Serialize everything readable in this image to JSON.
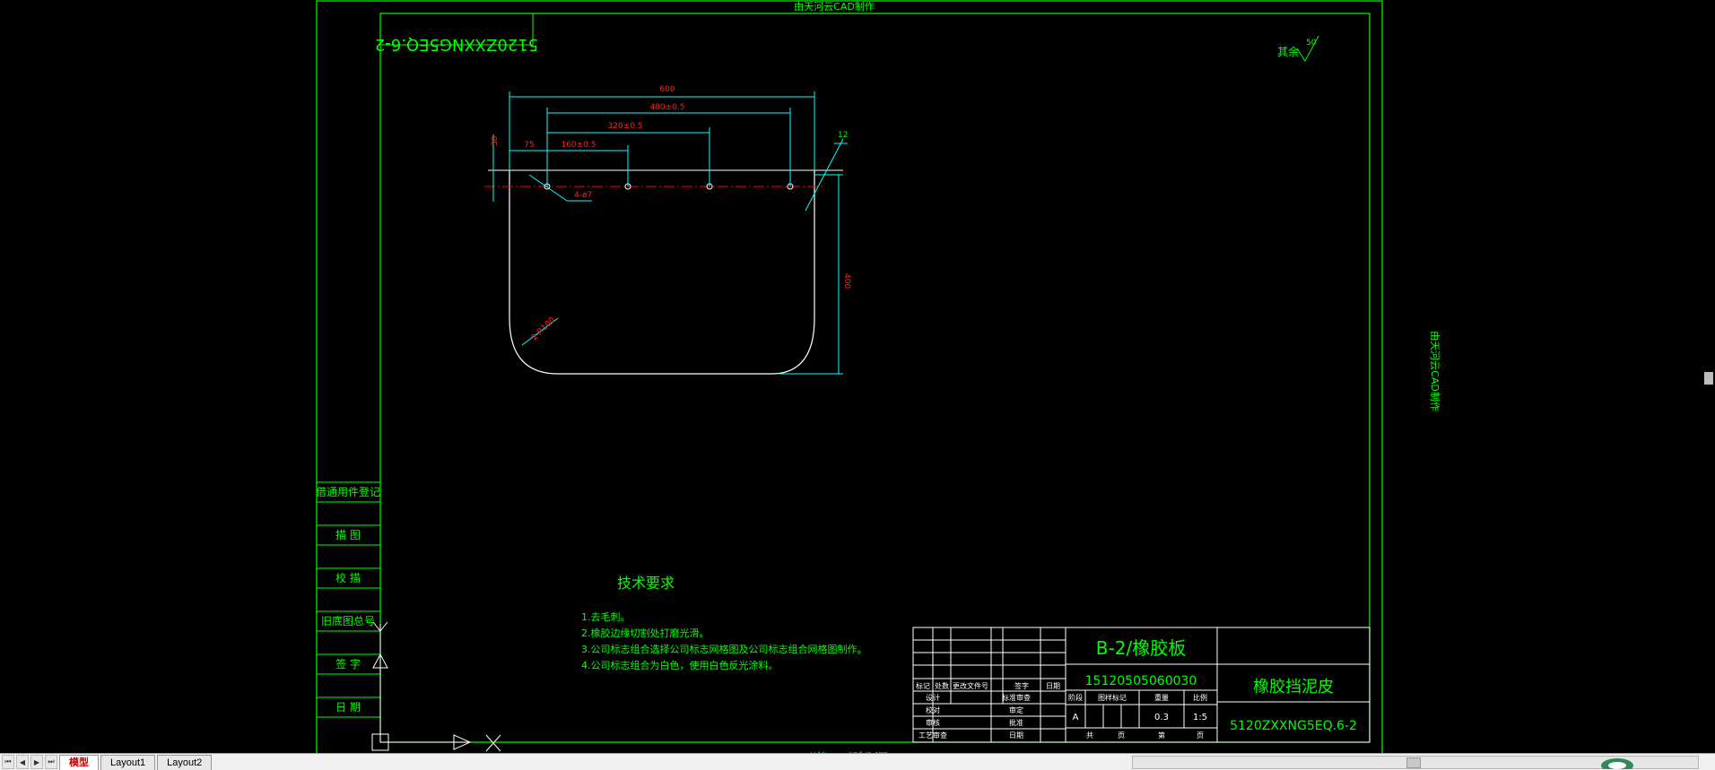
{
  "colors": {
    "frame": "#00ff00",
    "dimension": "#00ffff",
    "dim_text": "#ff2020",
    "note_text": "#00ff00",
    "outline": "#ffffff",
    "centerline": "#ff0000"
  },
  "watermark": "由天河云CAD制作",
  "drawing_number_mirrored": "5120ZXXNG5EQ.6-2",
  "roughness": {
    "label": "其余",
    "value": "50"
  },
  "dimensions": {
    "width_total": "600",
    "hole_span_480": "480±0.5",
    "hole_span_320": "320±0.5",
    "hole_span_160": "160±0.5",
    "offset_75": "75",
    "offset_30": "30",
    "height_400": "400",
    "holes": "4-ø7",
    "radius": "2-R100",
    "thickness": "12"
  },
  "left_column": [
    "借通用件登记",
    "描 图",
    "校 描",
    "旧底图总号",
    "签 字",
    "日 期"
  ],
  "tech_requirements": {
    "title": "技术要求",
    "items": [
      "1.去毛刺。",
      "2.橡胶边缘切割处打磨光滑。",
      "3.公司标志组合选择公司标志网格图及公司标志组合网格图制作。",
      "4.公司标志组合为白色，使用白色反光涂料。"
    ]
  },
  "title_block": {
    "material": "B-2/橡胶板",
    "part_code": "15120505060030",
    "part_name": "橡胶挡泥皮",
    "drawing_number": "5120ZXXNG5EQ.6-2",
    "change_headers": [
      "标记",
      "处数",
      "更改文件号",
      "签字",
      "日期"
    ],
    "sign_rows": [
      [
        "设计",
        "",
        "标准审查"
      ],
      [
        "校对",
        "",
        "审定"
      ],
      [
        "审核",
        "",
        "批准"
      ],
      [
        "工艺审查",
        "",
        "日期"
      ]
    ],
    "stage_headers": [
      "阶段",
      "图样标记",
      "重量",
      "比例"
    ],
    "stage_values": [
      "A",
      "",
      "",
      "",
      "0.3",
      "1:5"
    ],
    "sheet_row": [
      "共",
      "页",
      "第",
      "页"
    ]
  },
  "tabs": {
    "model": "模型",
    "layout1": "Layout1",
    "layout2": "Layout2"
  }
}
